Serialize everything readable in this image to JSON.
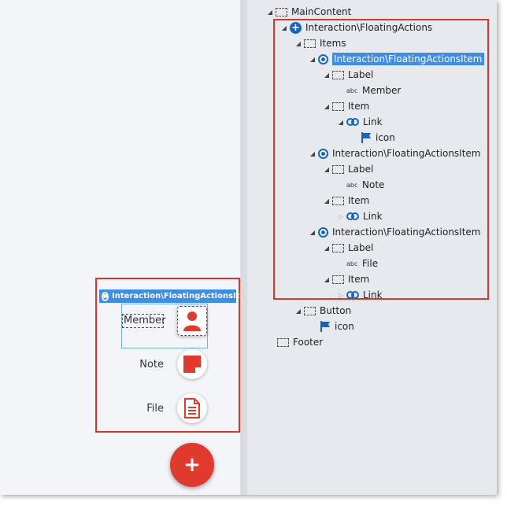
{
  "tree": {
    "main_content": "MainContent",
    "floating_actions": "Interaction\\FloatingActions",
    "items": "Items",
    "fa_item": "Interaction\\FloatingActionsItem",
    "label": "Label",
    "item": "Item",
    "link": "Link",
    "icon": "icon",
    "member": "Member",
    "note": "Note",
    "file": "File",
    "button": "Button",
    "footer": "Footer"
  },
  "preview": {
    "selected_tag": "Interaction\\FloatingActionsItem",
    "actions": [
      {
        "label": "Member",
        "icon": "user-icon"
      },
      {
        "label": "Note",
        "icon": "sticky-note-icon"
      },
      {
        "label": "File",
        "icon": "file-icon"
      }
    ],
    "main_button": "+"
  },
  "colors": {
    "accent": "#3d8ee6",
    "highlight_border": "#d9392b",
    "fab": "#e03a2e",
    "node_icon": "#1565c0"
  }
}
